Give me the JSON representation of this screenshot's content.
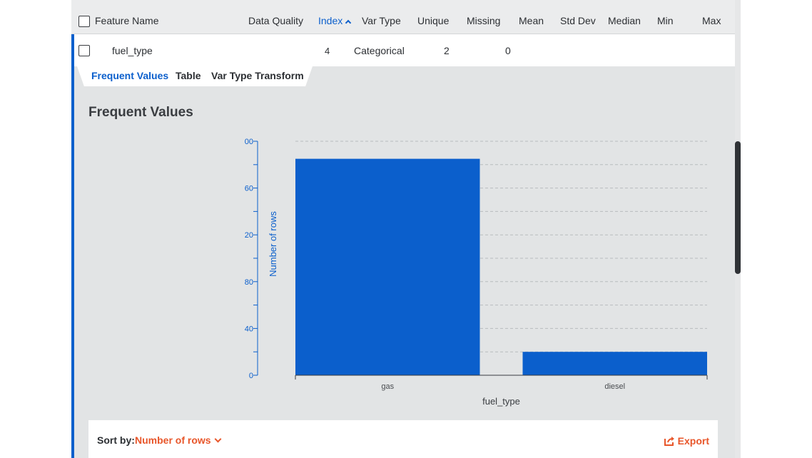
{
  "table": {
    "headers": {
      "feature_name": "Feature Name",
      "data_quality": "Data Quality",
      "index": "Index",
      "var_type": "Var Type",
      "unique": "Unique",
      "missing": "Missing",
      "mean": "Mean",
      "std_dev": "Std Dev",
      "median": "Median",
      "min": "Min",
      "max": "Max"
    },
    "sorted_column": "index",
    "sort_direction": "ascending",
    "row": {
      "feature_name": "fuel_type",
      "index": "4",
      "var_type": "Categorical",
      "unique": "2",
      "missing": "0"
    }
  },
  "detail": {
    "tabs": [
      "Frequent Values",
      "Table",
      "Var Type Transform"
    ],
    "active_tab": "Frequent Values",
    "section_title": "Frequent Values"
  },
  "chart_data": {
    "type": "bar",
    "categories": [
      "gas",
      "diesel"
    ],
    "values": [
      185,
      20
    ],
    "xlabel": "fuel_type",
    "ylabel": "Number of rows",
    "ylim": [
      0,
      200
    ],
    "yticks": [
      0,
      40,
      80,
      120,
      160,
      200
    ],
    "ytick_labels": [
      "0",
      "40",
      "80",
      "20",
      "60",
      "00"
    ],
    "grid": true,
    "bar_color": "#0b5fcc"
  },
  "sort_bar": {
    "label": "Sort by:",
    "value": "Number of rows",
    "export_label": "Export"
  },
  "colors": {
    "accent": "#0b5fcc",
    "action": "#e8562a"
  },
  "icons": {
    "sort": "sort-ascending-icon",
    "dropdown": "chevron-down-icon",
    "export": "export-icon"
  }
}
